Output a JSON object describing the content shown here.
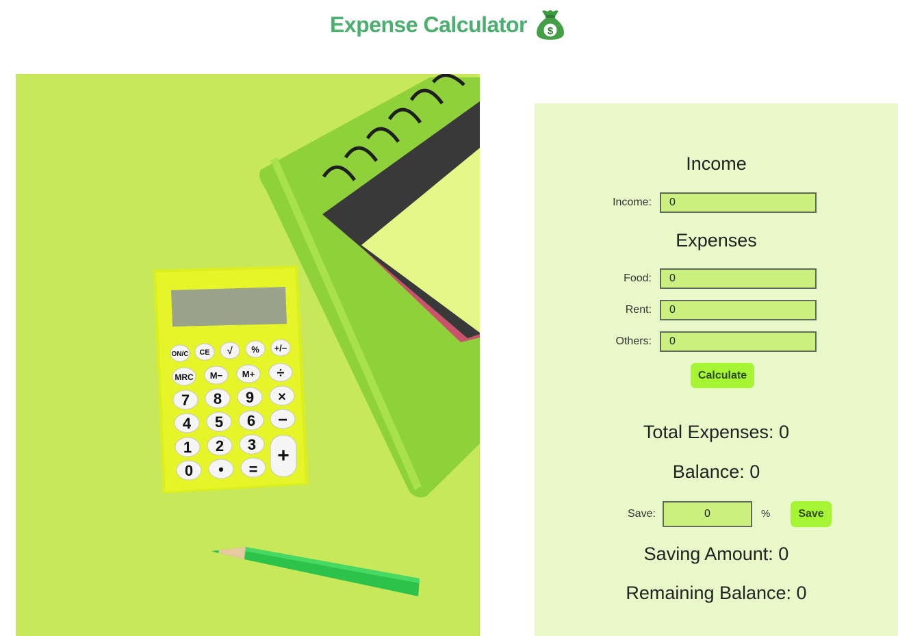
{
  "header": {
    "title": "Expense Calculator",
    "icon": "money-bag-icon"
  },
  "photo": {
    "subject": "calculator-notebook-pencil-photo"
  },
  "income_section": {
    "heading": "Income",
    "income": {
      "label": "Income:",
      "value": "0"
    }
  },
  "expenses_section": {
    "heading": "Expenses",
    "food": {
      "label": "Food:",
      "value": "0"
    },
    "rent": {
      "label": "Rent:",
      "value": "0"
    },
    "others": {
      "label": "Others:",
      "value": "0"
    }
  },
  "calculate_button": "Calculate",
  "results": {
    "total_expenses": "Total Expenses: 0",
    "balance": "Balance: 0",
    "saving_amount": "Saving Amount: 0",
    "remaining_balance": "Remaining Balance: 0"
  },
  "save": {
    "label": "Save:",
    "value": "0",
    "unit": "%",
    "button": "Save"
  },
  "colors": {
    "title": "#4caf70",
    "panel_bg": "#e8f8c8",
    "input_bg": "#cbf080",
    "button_bg": "#a6f534"
  }
}
